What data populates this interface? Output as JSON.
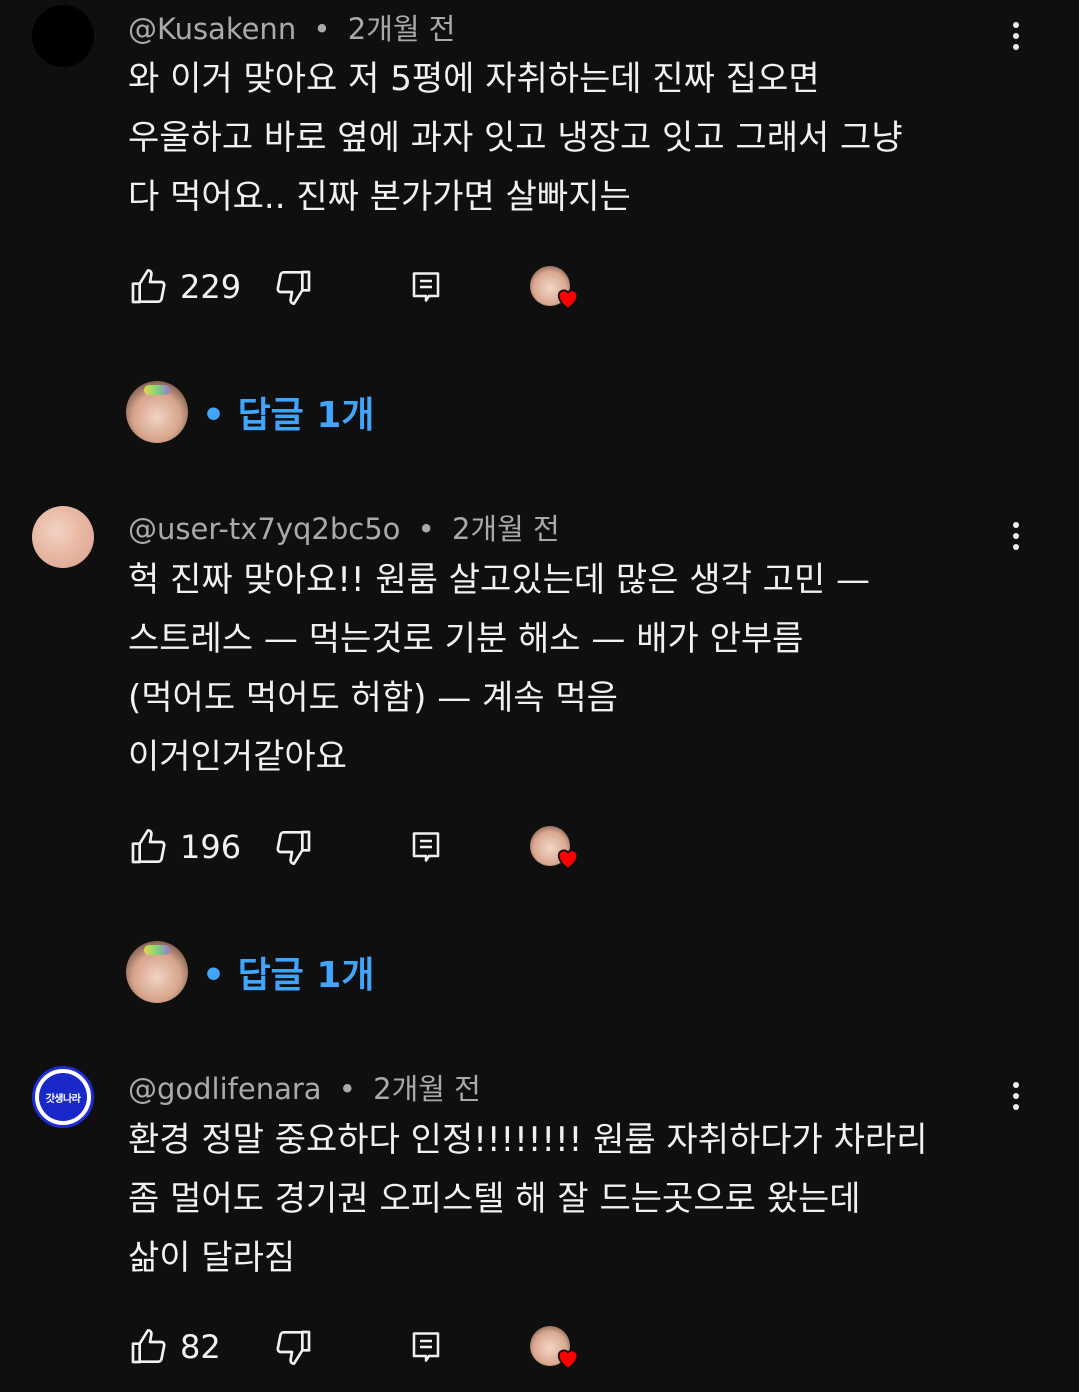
{
  "comments": [
    {
      "handle": "@Kusakenn",
      "time": "2개월 전",
      "lines": [
        "와 이거 맞아요 저 5평에 자취하는데 진짜 집오면",
        "우울하고 바로 옆에 과자 잇고 냉장고 잇고 그래서 그냥",
        "다 먹어요.. 진짜 본가가면 살빠지는"
      ],
      "likes": "229",
      "replies_label": "답글 1개"
    },
    {
      "handle": "@user-tx7yq2bc5o",
      "time": "2개월 전",
      "lines": [
        "헉 진짜 맞아요!! 원룸 살고있는데 많은 생각 고민 —",
        "스트레스 — 먹는것로 기분 해소 — 배가 안부름",
        "(먹어도 먹어도 허함) — 계속 먹음",
        "이거인거같아요"
      ],
      "likes": "196",
      "replies_label": "답글 1개"
    },
    {
      "handle": "@godlifenara",
      "time": "2개월 전",
      "avatar_text": "갓생나라",
      "lines": [
        "환경 정말 중요하다 인정!!!!!!!! 원룸 자취하다가 차라리",
        "좀 멀어도 경기권 오피스텔 해 잘 드는곳으로 왔는데",
        "삶이 달라짐"
      ],
      "likes": "82"
    }
  ],
  "separator": "•",
  "colors": {
    "background": "#0f0f0f",
    "text": "#f1f1f1",
    "meta": "#aaaaaa",
    "reply_link": "#3ea6ff",
    "heart": "#ff0000"
  },
  "icons": [
    "like-icon",
    "dislike-icon",
    "reply-icon",
    "creator-heart-icon",
    "more-vert-icon"
  ]
}
